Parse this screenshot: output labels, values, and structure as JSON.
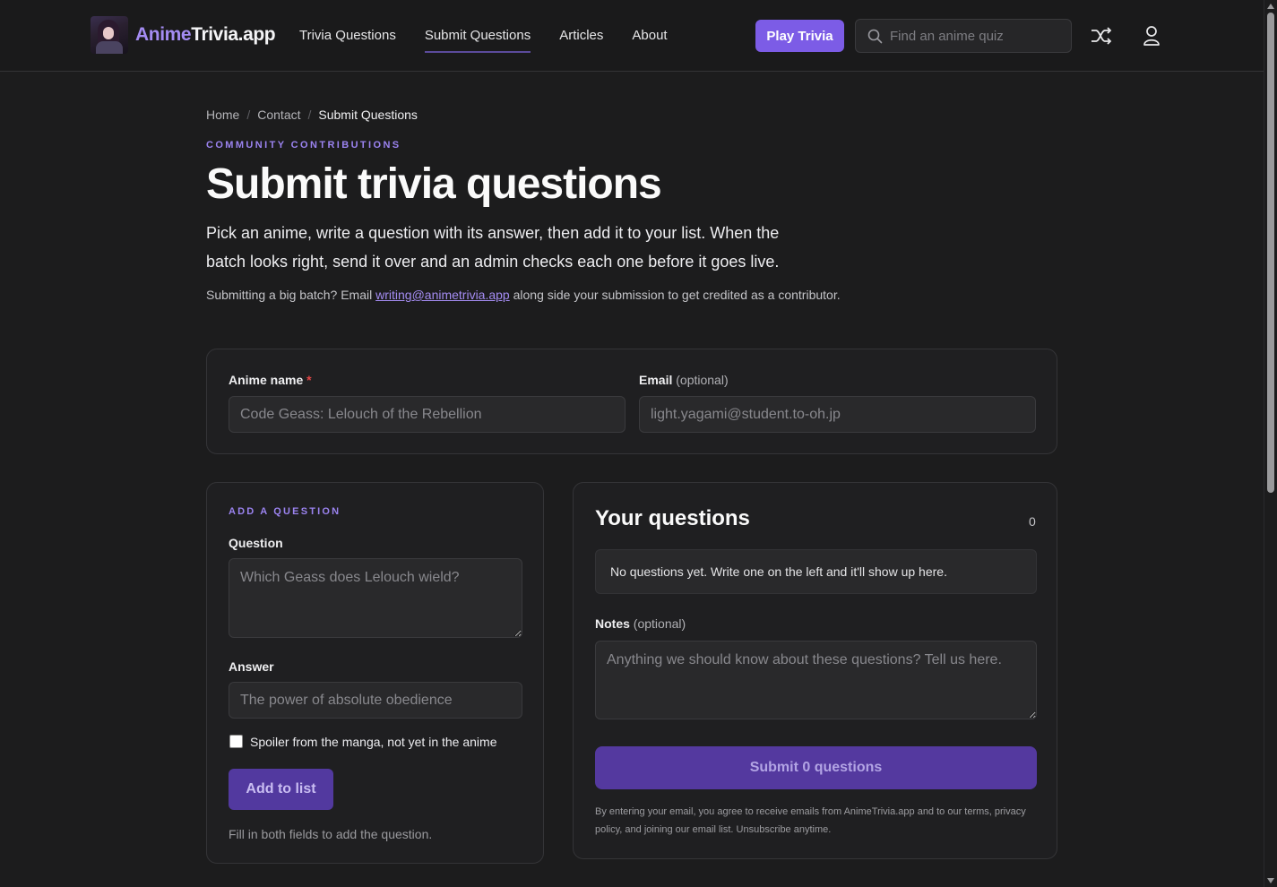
{
  "header": {
    "logo_part1": "Anime",
    "logo_part2": "Trivia.app",
    "nav": [
      {
        "label": "Trivia Questions"
      },
      {
        "label": "Submit Questions",
        "active": true
      },
      {
        "label": "Articles"
      },
      {
        "label": "About"
      }
    ],
    "play_label": "Play Trivia",
    "search_placeholder": "Find an anime quiz"
  },
  "breadcrumb": [
    "Home",
    "Contact",
    "Submit Questions"
  ],
  "hero": {
    "eyebrow": "COMMUNITY CONTRIBUTIONS",
    "title": "Submit trivia questions",
    "lead": "Pick an anime, write a question with its answer, then add it to your list. When the batch looks right, send it over and an admin checks each one before it goes live.",
    "note_prefix": "Submitting a big batch? Email ",
    "note_email": "writing@animetrivia.app",
    "note_suffix": " along side your submission to get credited as a contributor."
  },
  "top_form": {
    "anime_label": "Anime name",
    "anime_required_mark": "*",
    "anime_placeholder": "Code Geass: Lelouch of the Rebellion",
    "email_label": "Email",
    "email_optional": "(optional)",
    "email_placeholder": "light.yagami@student.to-oh.jp"
  },
  "add_question": {
    "eyebrow": "ADD A QUESTION",
    "question_label": "Question",
    "question_placeholder": "Which Geass does Lelouch wield?",
    "answer_label": "Answer",
    "answer_placeholder": "The power of absolute obedience",
    "spoiler_label": "Spoiler from the manga, not yet in the anime",
    "spoiler_checked": false,
    "add_label": "Add to list",
    "hint": "Fill in both fields to add the question."
  },
  "your_questions": {
    "title": "Your questions",
    "count": "0",
    "empty_text": "No questions yet. Write one on the left and it'll show up here.",
    "notes_label": "Notes",
    "notes_optional": "(optional)",
    "notes_placeholder": "Anything we should know about these questions? Tell us here.",
    "submit_label": "Submit 0 questions",
    "disclaimer": "By entering your email, you agree to receive emails from AnimeTrivia.app and to our terms, privacy policy, and joining our email list. Unsubscribe anytime."
  },
  "colors": {
    "accent": "#7c5ce6",
    "accent_text": "#a48cf2",
    "background": "#1c1c1d",
    "card": "#1f1f21",
    "required": "#e04646"
  },
  "icons": [
    "search-icon",
    "shuffle-icon",
    "user-icon"
  ]
}
